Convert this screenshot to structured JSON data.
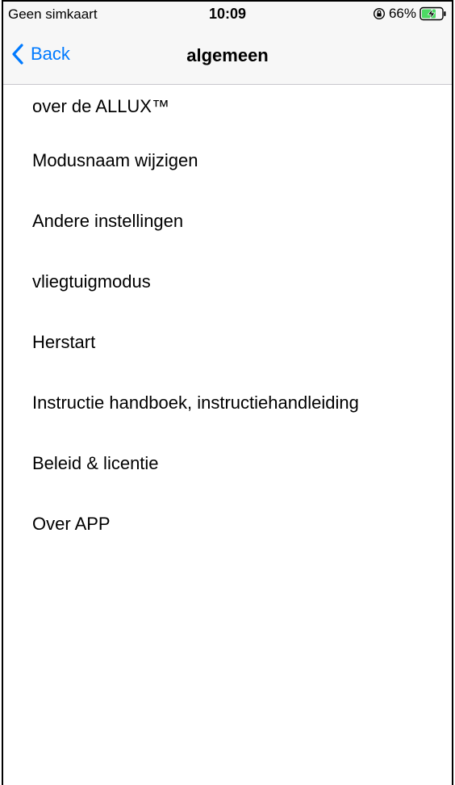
{
  "status_bar": {
    "carrier": "Geen simkaart",
    "time": "10:09",
    "battery_percent": "66%"
  },
  "nav_bar": {
    "back_label": "Back",
    "title": "algemeen"
  },
  "menu": {
    "items": [
      {
        "label": "over de ALLUX™"
      },
      {
        "label": "Modusnaam wijzigen"
      },
      {
        "label": "Andere instellingen"
      },
      {
        "label": "vliegtuigmodus"
      },
      {
        "label": "Herstart"
      },
      {
        "label": "Instructie handboek, instructiehandleiding"
      },
      {
        "label": "Beleid & licentie"
      },
      {
        "label": "Over APP"
      }
    ]
  },
  "colors": {
    "accent": "#007aff",
    "battery_charging": "#4cd964",
    "bar_background": "#f7f7f7"
  }
}
